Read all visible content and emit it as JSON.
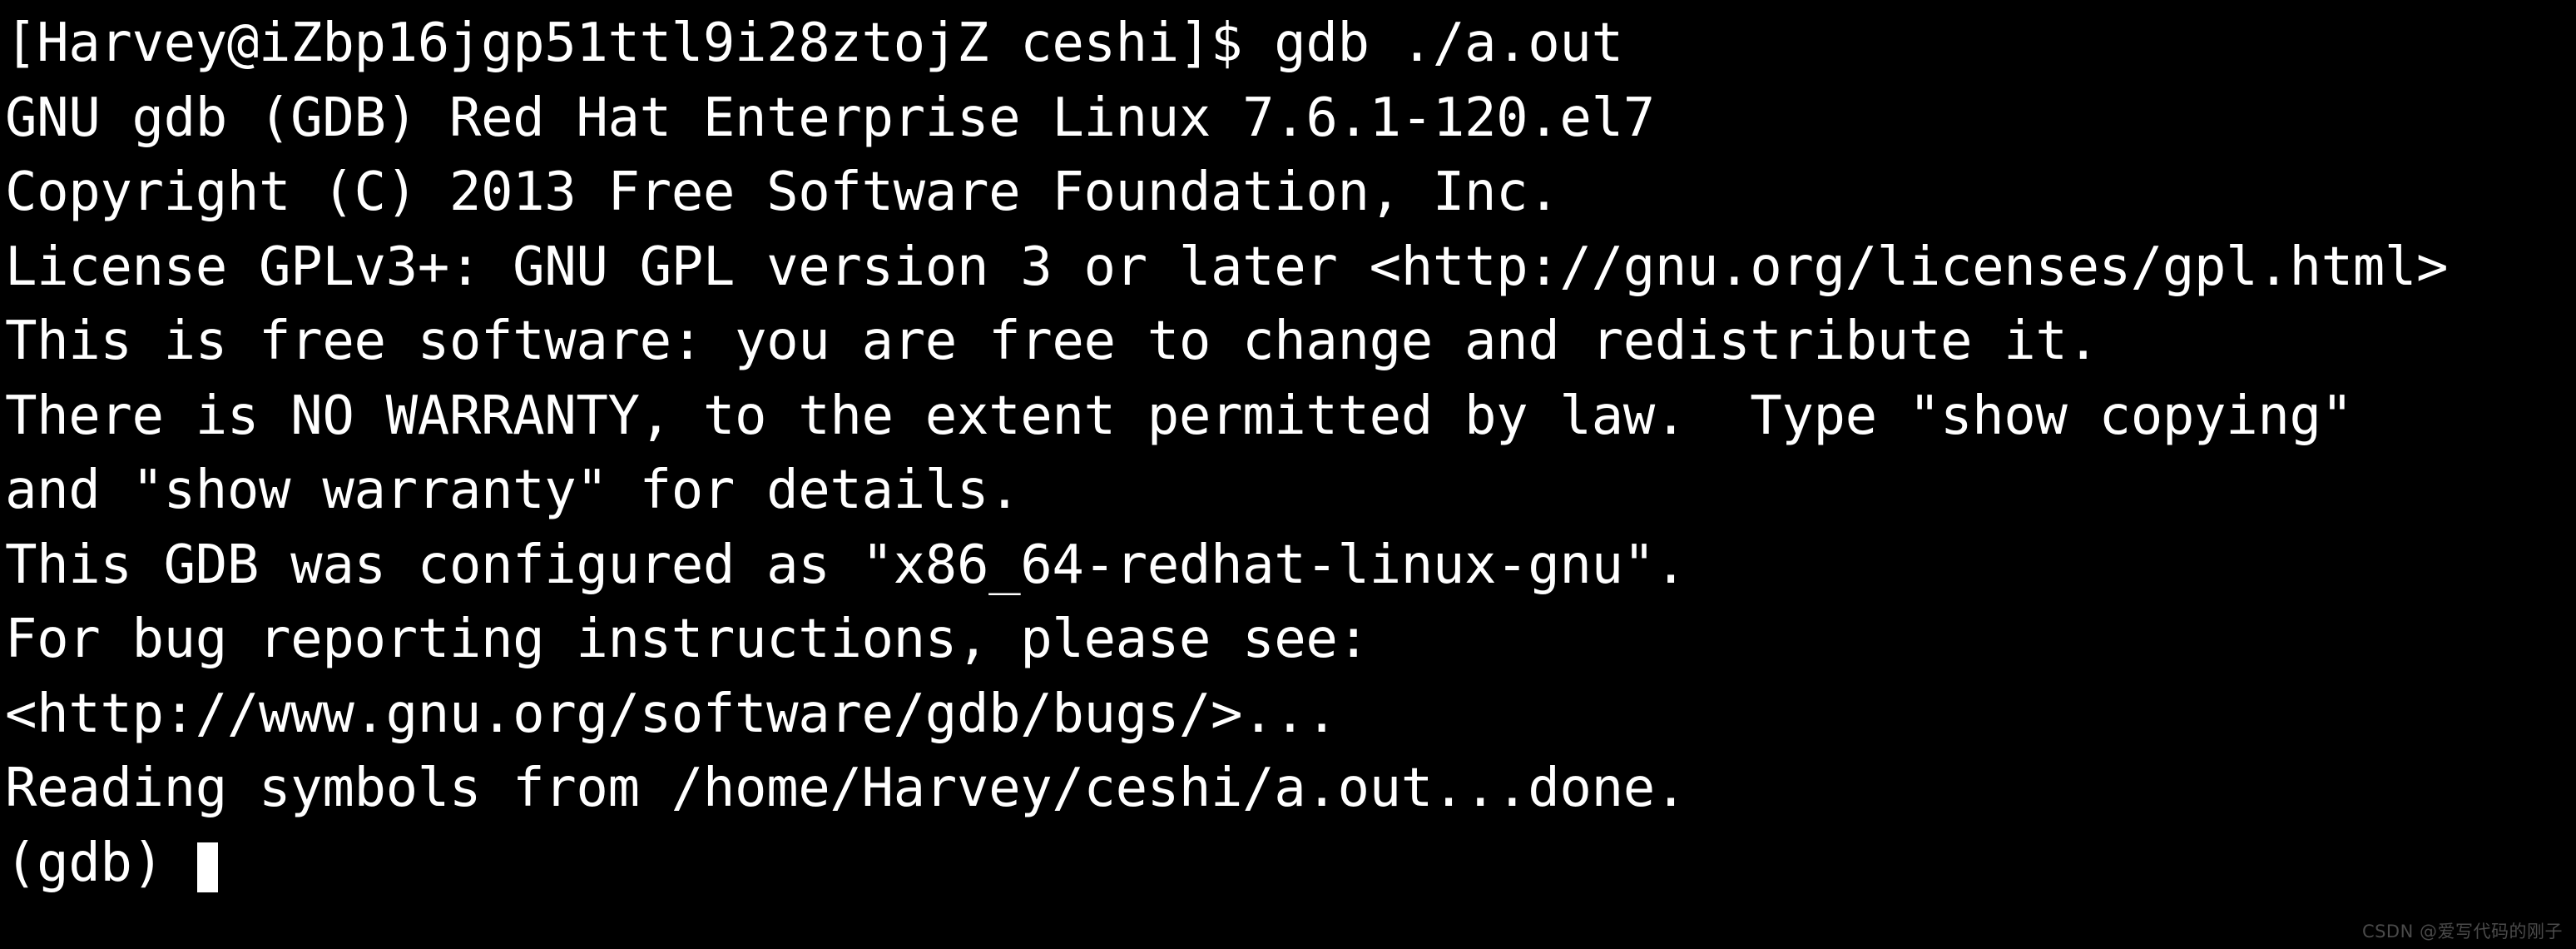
{
  "terminal": {
    "background_color": "#000000",
    "foreground_color": "#ffffff",
    "cursor": {
      "style": "block",
      "color": "#ffffff"
    },
    "lines": [
      "[Harvey@iZbp16jgp51ttl9i28ztojZ ceshi]$ gdb ./a.out",
      "GNU gdb (GDB) Red Hat Enterprise Linux 7.6.1-120.el7",
      "Copyright (C) 2013 Free Software Foundation, Inc.",
      "License GPLv3+: GNU GPL version 3 or later <http://gnu.org/licenses/gpl.html>",
      "This is free software: you are free to change and redistribute it.",
      "There is NO WARRANTY, to the extent permitted by law.  Type \"show copying\"",
      "and \"show warranty\" for details.",
      "This GDB was configured as \"x86_64-redhat-linux-gnu\".",
      "For bug reporting instructions, please see:",
      "<http://www.gnu.org/software/gdb/bugs/>...",
      "Reading symbols from /home/Harvey/ceshi/a.out...done."
    ],
    "prompt": "(gdb) ",
    "command_entered": "",
    "shell_user": "Harvey",
    "shell_host": "iZbp16jgp51ttl9i28ztojZ",
    "shell_cwd": "ceshi",
    "shell_symbol": "$",
    "command_run": "gdb ./a.out",
    "debugger": {
      "name": "GNU gdb",
      "distribution": "Red Hat Enterprise Linux",
      "version": "7.6.1-120.el7",
      "copyright_year": "2013",
      "license": "GPLv3+",
      "license_url": "http://gnu.org/licenses/gpl.html",
      "target_triple": "x86_64-redhat-linux-gnu",
      "bug_url": "http://www.gnu.org/software/gdb/bugs/",
      "symbols_file": "/home/Harvey/ceshi/a.out",
      "symbols_status": "done."
    }
  },
  "watermark": {
    "text": "CSDN @爱写代码的刚子",
    "color": "#4a4a4a"
  }
}
